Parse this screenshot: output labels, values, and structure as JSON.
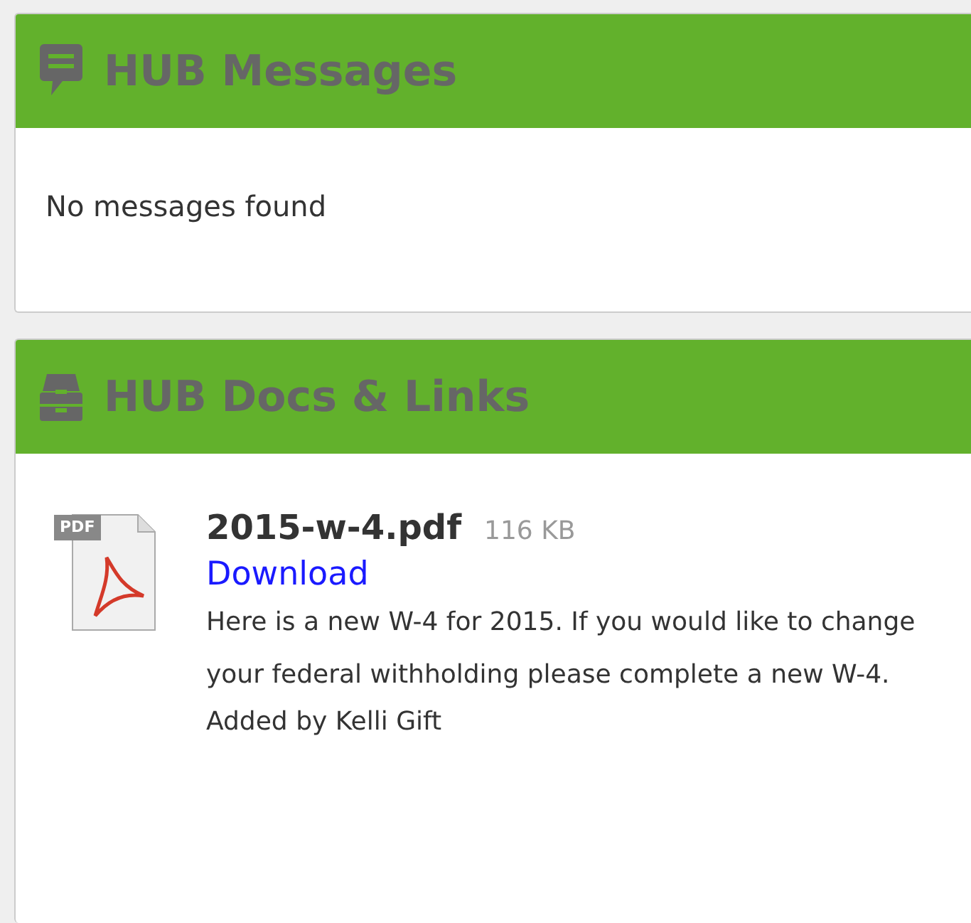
{
  "panels": [
    {
      "title": "HUB Messages",
      "kind": "chat",
      "empty_text": "No messages found"
    },
    {
      "title": "HUB Docs & Links",
      "kind": "cabinet",
      "documents": [
        {
          "file_badge": "PDF",
          "name": "2015-w-4.pdf",
          "size": "116 KB",
          "link": "Download",
          "description": "Here is a new W-4 for 2015. If you would like to change your federal withholding please complete a new W-4.",
          "added_by": "Added by Kelli Gift"
        }
      ]
    }
  ]
}
